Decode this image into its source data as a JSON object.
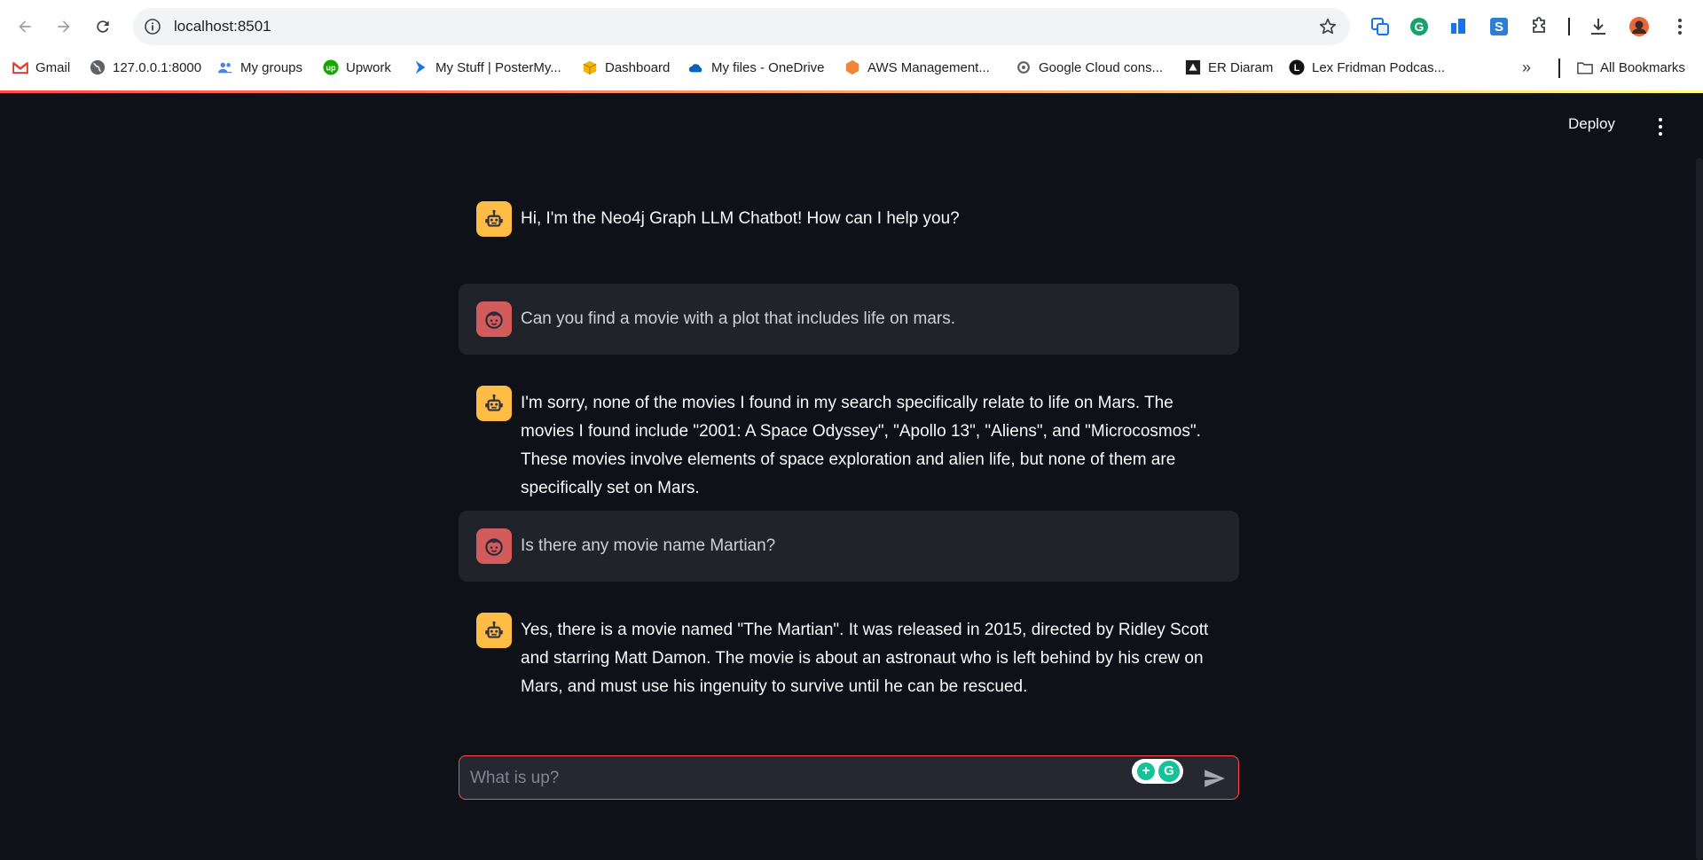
{
  "browser": {
    "url": "localhost:8501",
    "bookmarks": [
      {
        "label": "Gmail",
        "icon": "gmail-icon"
      },
      {
        "label": "127.0.0.1:8000",
        "icon": "globe-icon"
      },
      {
        "label": "My groups",
        "icon": "groups-icon"
      },
      {
        "label": "Upwork",
        "icon": "upwork-icon"
      },
      {
        "label": "My Stuff | PosterMy...",
        "icon": "postermywall-icon"
      },
      {
        "label": "Dashboard",
        "icon": "box-icon"
      },
      {
        "label": "My files - OneDrive",
        "icon": "onedrive-icon"
      },
      {
        "label": "AWS Management...",
        "icon": "aws-icon"
      },
      {
        "label": "Google Cloud cons...",
        "icon": "gcloud-icon"
      },
      {
        "label": "ER Diaram",
        "icon": "er-icon"
      },
      {
        "label": "Lex Fridman Podcas...",
        "icon": "lex-icon"
      }
    ],
    "all_bookmarks": "All Bookmarks"
  },
  "app": {
    "deploy_label": "Deploy",
    "messages": [
      {
        "role": "assistant",
        "text": "Hi, I'm the Neo4j Graph LLM Chatbot! How can I help you?"
      },
      {
        "role": "user",
        "text": "Can you find a movie with a plot that includes life on mars."
      },
      {
        "role": "assistant",
        "text": "I'm sorry, none of the movies I found in my search specifically relate to life on Mars. The movies I found include \"2001: A Space Odyssey\", \"Apollo 13\", \"Aliens\", and \"Microcosmos\". These movies involve elements of space exploration and alien life, but none of them are specifically set on Mars."
      },
      {
        "role": "user",
        "text": "Is there any movie name Martian?"
      },
      {
        "role": "assistant",
        "text": "Yes, there is a movie named \"The Martian\". It was released in 2015, directed by Ridley Scott and starring Matt Damon. The movie is about an astronaut who is left behind by his crew on Mars, and must use his ingenuity to survive until he can be rescued."
      }
    ],
    "input": {
      "placeholder": "What is up?",
      "value": ""
    }
  },
  "colors": {
    "bg": "#0e1117",
    "bot_avatar": "#ffbd45",
    "user_avatar": "#ff6c6c",
    "accent": "#ff4b4b"
  }
}
